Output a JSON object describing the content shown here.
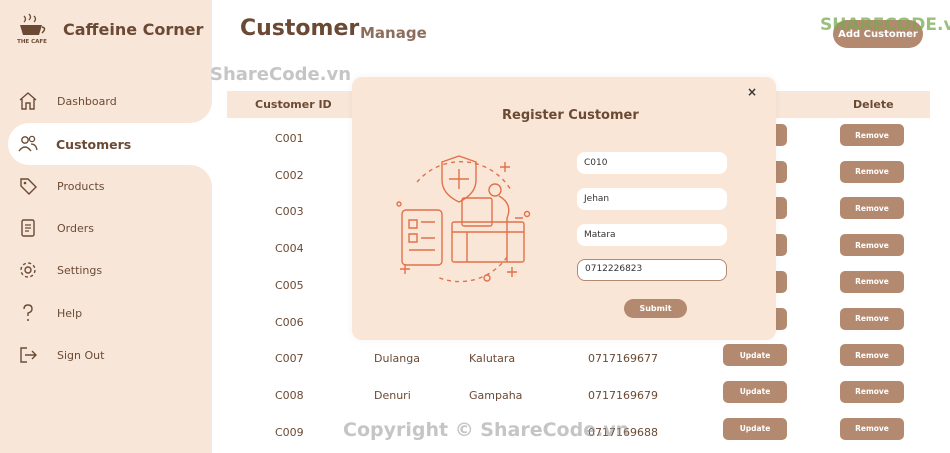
{
  "brand": {
    "name": "Caffeine Corner",
    "logo_text": "THE CAFE"
  },
  "nav": [
    {
      "label": "Dashboard",
      "icon": "home-icon"
    },
    {
      "label": "Customers",
      "icon": "users-icon"
    },
    {
      "label": "Products",
      "icon": "tag-icon"
    },
    {
      "label": "Orders",
      "icon": "document-icon"
    },
    {
      "label": "Settings",
      "icon": "gear-icon"
    },
    {
      "label": "Help",
      "icon": "question-icon"
    },
    {
      "label": "Sign Out",
      "icon": "signout-icon"
    }
  ],
  "header": {
    "title": "Customer",
    "subtitle": "Manage",
    "add_button": "Add Customer"
  },
  "table": {
    "columns": [
      "Customer ID",
      "Delete"
    ],
    "rows": [
      {
        "id": "C001",
        "name": "",
        "city": "",
        "phone": "",
        "update": "Update",
        "remove": "Remove"
      },
      {
        "id": "C002",
        "name": "",
        "city": "",
        "phone": "",
        "update": "Update",
        "remove": "Remove"
      },
      {
        "id": "C003",
        "name": "",
        "city": "",
        "phone": "",
        "update": "Update",
        "remove": "Remove"
      },
      {
        "id": "C004",
        "name": "",
        "city": "",
        "phone": "",
        "update": "Update",
        "remove": "Remove"
      },
      {
        "id": "C005",
        "name": "",
        "city": "",
        "phone": "",
        "update": "Update",
        "remove": "Remove"
      },
      {
        "id": "C006",
        "name": "",
        "city": "",
        "phone": "",
        "update": "Update",
        "remove": "Remove"
      },
      {
        "id": "C007",
        "name": "Dulanga",
        "city": "Kalutara",
        "phone": "0717169677",
        "update": "Update",
        "remove": "Remove"
      },
      {
        "id": "C008",
        "name": "Denuri",
        "city": "Gampaha",
        "phone": "0717169679",
        "update": "Update",
        "remove": "Remove"
      },
      {
        "id": "C009",
        "name": "",
        "city": "",
        "phone": "0717169688",
        "update": "Update",
        "remove": "Remove"
      }
    ]
  },
  "modal": {
    "title": "Register Customer",
    "close": "×",
    "fields": [
      "C010",
      "Jehan",
      "Matara",
      "0712226823"
    ],
    "submit": "Submit"
  },
  "watermarks": {
    "logo": "SHARECODE.vn",
    "top": "ShareCode.vn",
    "bottom": "Copyright © ShareCode.vn"
  },
  "colors": {
    "sidebar_bg": "#f8e7d8",
    "accent": "#b3896f",
    "text": "#6b4a35",
    "modal_bg": "#fae6d7",
    "illustration": "#e0714b"
  }
}
